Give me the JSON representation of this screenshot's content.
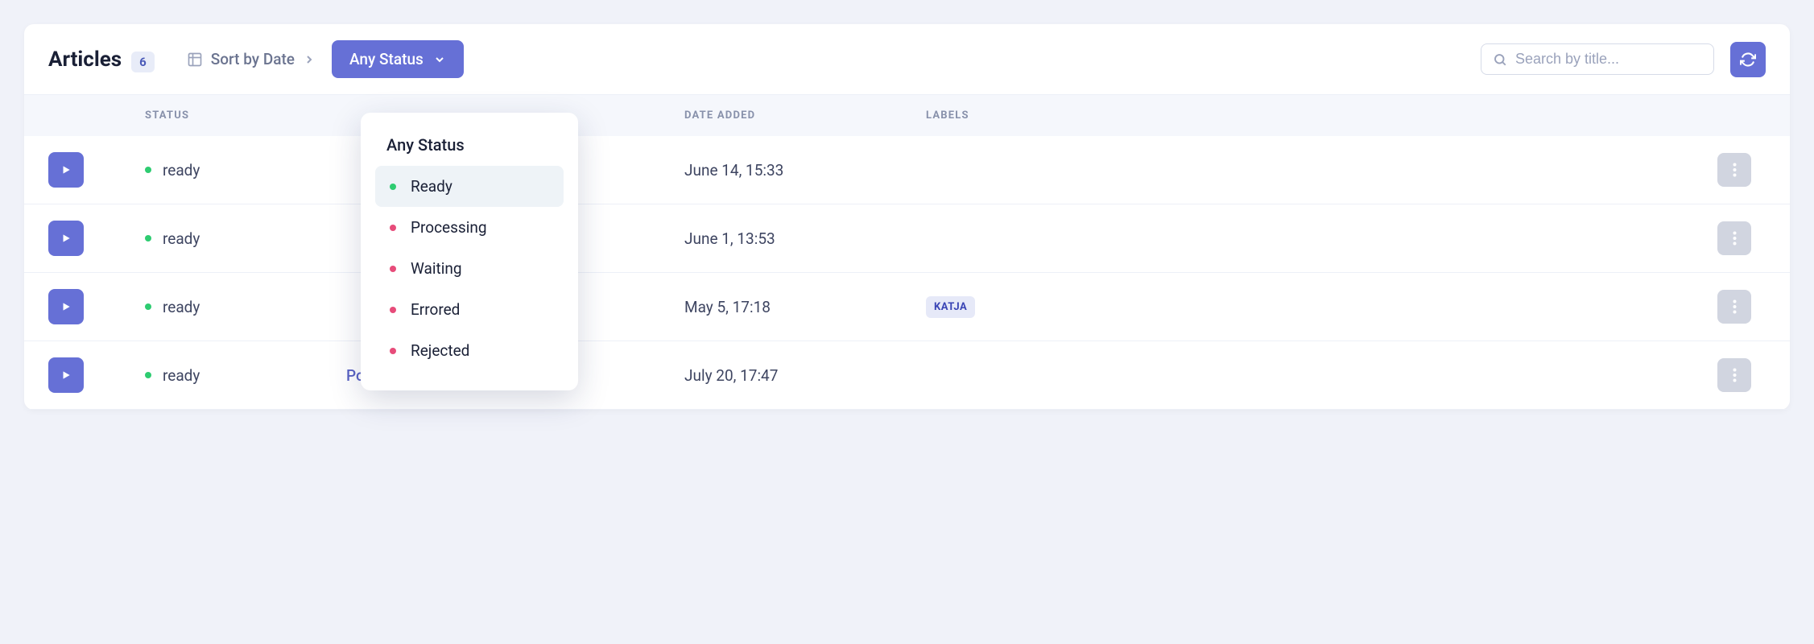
{
  "header": {
    "title": "Articles",
    "count": "6",
    "sort_label": "Sort by Date",
    "status_label": "Any Status",
    "search_placeholder": "Search by title..."
  },
  "columns": {
    "status": "STATUS",
    "date": "DATE ADDED",
    "labels": "LABELS"
  },
  "dropdown": {
    "title": "Any Status",
    "items": [
      {
        "label": "Ready",
        "color": "green",
        "highlighted": true
      },
      {
        "label": "Processing",
        "color": "pink",
        "highlighted": false
      },
      {
        "label": "Waiting",
        "color": "pink",
        "highlighted": false
      },
      {
        "label": "Errored",
        "color": "pink",
        "highlighted": false
      },
      {
        "label": "Rejected",
        "color": "pink",
        "highlighted": false
      }
    ]
  },
  "rows": [
    {
      "status": "ready",
      "title": "",
      "date": "June 14, 15:33",
      "label": ""
    },
    {
      "status": "ready",
      "title": "",
      "date": "June 1, 13:53",
      "label": ""
    },
    {
      "status": "ready",
      "title": "",
      "date": "May 5, 17:18",
      "label": "KATJA"
    },
    {
      "status": "ready",
      "title": "Podcast",
      "date": "July 20, 17:47",
      "label": ""
    }
  ]
}
